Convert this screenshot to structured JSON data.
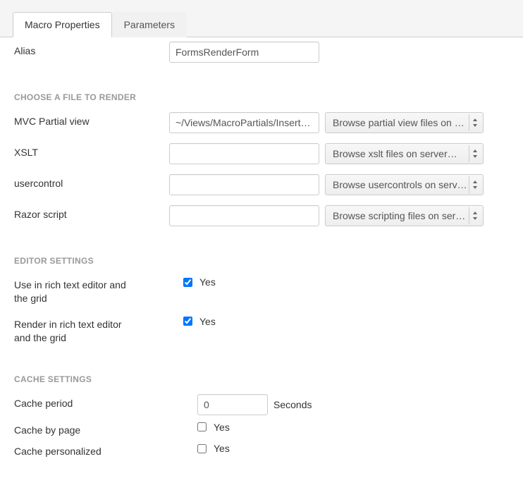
{
  "tabs": {
    "macro_properties": "Macro Properties",
    "parameters": "Parameters"
  },
  "alias": {
    "label": "Alias",
    "value": "FormsRenderForm"
  },
  "section_choose_file": "CHOOSE A FILE TO RENDER",
  "mvc": {
    "label": "MVC Partial view",
    "value": "~/Views/MacroPartials/InsertUmbracoFormWithTheme.cshtml",
    "browse": "Browse partial view files on server…"
  },
  "xslt": {
    "label": "XSLT",
    "value": "",
    "browse": "Browse xslt files on server…"
  },
  "usercontrol": {
    "label": "usercontrol",
    "value": "",
    "browse": "Browse usercontrols on server…"
  },
  "razor": {
    "label": "Razor script",
    "value": "",
    "browse": "Browse scripting files on server…"
  },
  "section_editor": "EDITOR SETTINGS",
  "use_in_editor": {
    "label": "Use in rich text editor and the grid",
    "yes": "Yes"
  },
  "render_in_editor": {
    "label": "Render in rich text editor and the grid",
    "yes": "Yes"
  },
  "section_cache": "CACHE SETTINGS",
  "cache_period": {
    "label": "Cache period",
    "value": "0",
    "unit": "Seconds"
  },
  "cache_by_page": {
    "label": "Cache by page",
    "yes": "Yes"
  },
  "cache_personalized": {
    "label": "Cache personalized",
    "yes": "Yes"
  }
}
